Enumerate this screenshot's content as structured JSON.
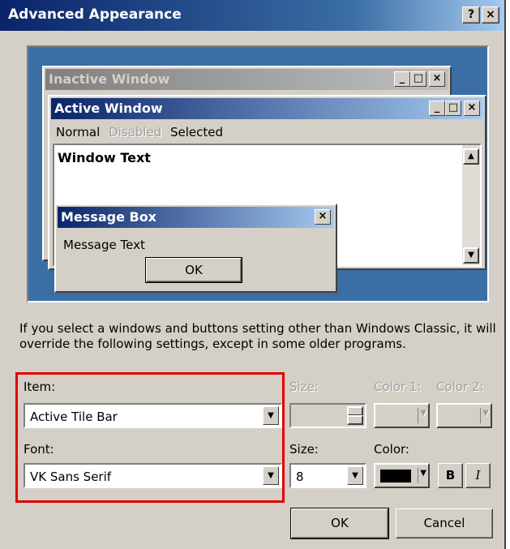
{
  "dialog": {
    "title": "Advanced Appearance",
    "help_label": "?",
    "close_label": "×"
  },
  "preview": {
    "inactive_window": {
      "title": "Inactive Window"
    },
    "active_window": {
      "title": "Active Window",
      "menu": [
        "Normal",
        "Disabled",
        "Selected"
      ],
      "window_text": "Window Text"
    },
    "message_box": {
      "title": "Message Box",
      "text": "Message Text",
      "ok_label": "OK"
    },
    "caption_buttons": {
      "minimize": "_",
      "maximize": "□",
      "close": "×"
    }
  },
  "description": "If you select a windows and buttons setting other than Windows Classic, it will override the following settings, except in some older programs.",
  "item_row": {
    "item_label": "Item:",
    "item_value": "Active Tile Bar",
    "size_label": "Size:",
    "color1_label": "Color 1:",
    "color2_label": "Color 2:"
  },
  "font_row": {
    "font_label": "Font:",
    "font_value": "VK Sans Serif",
    "size_label": "Size:",
    "size_value": "8",
    "color_label": "Color:",
    "color_value": "#000000",
    "bold_label": "B",
    "italic_label": "I"
  },
  "buttons": {
    "ok": "OK",
    "cancel": "Cancel"
  },
  "colors": {
    "highlight": "#e00000",
    "active_title": "#0a246a",
    "inactive_title": "#808080",
    "desktop": "#3a6ea5",
    "face": "#d4d0c8"
  }
}
